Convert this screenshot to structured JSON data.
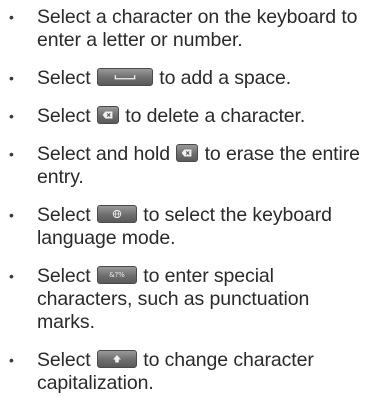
{
  "steps": [
    {
      "id": "enter-char",
      "segments": [
        "Select a character on the keyboard to enter a letter or number.",
        ""
      ]
    },
    {
      "id": "space",
      "segments": [
        "Select",
        "to add a space."
      ],
      "key": {
        "icon": "space-bar-icon"
      }
    },
    {
      "id": "delete",
      "segments": [
        "Select",
        "to delete a character."
      ],
      "key": {
        "icon": "backspace-icon"
      }
    },
    {
      "id": "erase",
      "segments": [
        "Select and hold",
        "to erase the entire entry."
      ],
      "key": {
        "icon": "backspace-icon"
      }
    },
    {
      "id": "language",
      "segments": [
        "Select",
        "to select the keyboard language mode."
      ],
      "key": {
        "icon": "globe-icon"
      }
    },
    {
      "id": "special",
      "segments": [
        "Select",
        "to enter special characters, such as punctuation marks."
      ],
      "key": {
        "icon": "special-characters-icon",
        "label": "&?%"
      }
    },
    {
      "id": "caps",
      "segments": [
        "Select",
        "to change character capitalization."
      ],
      "key": {
        "icon": "shift-arrow-icon"
      }
    }
  ],
  "bullet": "•",
  "colors": {
    "text": "#2a2a2a",
    "key_light": "#9a9a9a",
    "key_dark": "#5a5a5a",
    "key_glyph": "#eeeeee"
  }
}
